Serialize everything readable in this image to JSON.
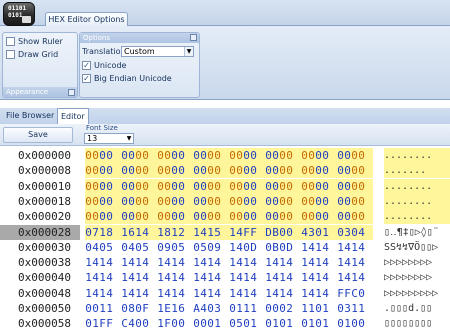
{
  "app": {
    "orb_line1": "01101",
    "orb_line2": "0101"
  },
  "ribbon": {
    "tab_label": "HEX Editor Options",
    "appearance_group": {
      "label": "Appearance",
      "show_ruler": "Show Ruler",
      "draw_grid": "Draw Grid"
    },
    "options_group": {
      "label": "Options",
      "translation_label": "Translation",
      "translation_value": "Custom",
      "unicode": "Unicode",
      "big_endian": "Big Endian Unicode"
    }
  },
  "doc_tabs": {
    "file_browser": "File Browser",
    "editor": "Editor"
  },
  "toolbar": {
    "save_label": "Save",
    "font_size_label": "Font Size",
    "font_size_value": "13"
  },
  "hex": {
    "rows": [
      {
        "addr": "0x000000",
        "bytes": [
          "0000",
          "0000",
          "0000",
          "0000",
          "0000",
          "0000",
          "0000",
          "0000"
        ],
        "ascii": "........"
      },
      {
        "addr": "0x000008",
        "bytes": [
          "0000",
          "0000",
          "0000",
          "0000",
          "0000",
          "0000",
          "0000",
          "0000"
        ],
        "ascii": "......."
      },
      {
        "addr": "0x000010",
        "bytes": [
          "0000",
          "0000",
          "0000",
          "0000",
          "0000",
          "0000",
          "0000",
          "0000"
        ],
        "ascii": "........"
      },
      {
        "addr": "0x000018",
        "bytes": [
          "0000",
          "0000",
          "0000",
          "0000",
          "0000",
          "0000",
          "0000",
          "0000"
        ],
        "ascii": "........"
      },
      {
        "addr": "0x000020",
        "bytes": [
          "0000",
          "0000",
          "0000",
          "0000",
          "0000",
          "0000",
          "0000",
          "0000"
        ],
        "ascii": "........"
      },
      {
        "addr": "0x000028",
        "bytes": [
          "0718",
          "1614",
          "1812",
          "1415",
          "14FF",
          "DB00",
          "4301",
          "0304"
        ],
        "ascii": "▯‥¶‡▯▷◊▯¨"
      },
      {
        "addr": "0x000030",
        "bytes": [
          "0405",
          "0405",
          "0905",
          "0509",
          "140D",
          "0B0D",
          "1414",
          "1414"
        ],
        "ascii": "SS↯↯∇Ö▯▯▷"
      },
      {
        "addr": "0x000038",
        "bytes": [
          "1414",
          "1414",
          "1414",
          "1414",
          "1414",
          "1414",
          "1414",
          "1414"
        ],
        "ascii": "▷▷▷▷▷▷▷▷"
      },
      {
        "addr": "0x000040",
        "bytes": [
          "1414",
          "1414",
          "1414",
          "1414",
          "1414",
          "1414",
          "1414",
          "1414"
        ],
        "ascii": "▷▷▷▷▷▷▷▷"
      },
      {
        "addr": "0x000048",
        "bytes": [
          "1414",
          "1414",
          "1414",
          "1414",
          "1414",
          "1414",
          "1414",
          "FFC0"
        ],
        "ascii": "▷▷▷▷▷▷▷▷▷"
      },
      {
        "addr": "0x000050",
        "bytes": [
          "0011",
          "080F",
          "1E16",
          "A403",
          "0111",
          "0002",
          "1101",
          "0311"
        ],
        "ascii": ".▯▯▯d.▯▯"
      },
      {
        "addr": "0x000058",
        "bytes": [
          "01FF",
          "C400",
          "1F00",
          "0001",
          "0501",
          "0101",
          "0101",
          "0100"
        ],
        "ascii": "▯▯▯▯▯▯▯▯"
      }
    ]
  },
  "colors": {
    "highlight": "#fff59a",
    "selection_bg": "#a9a9a9",
    "hex_text": "#1f3fbf",
    "changed_nibble": "#c46a00"
  }
}
